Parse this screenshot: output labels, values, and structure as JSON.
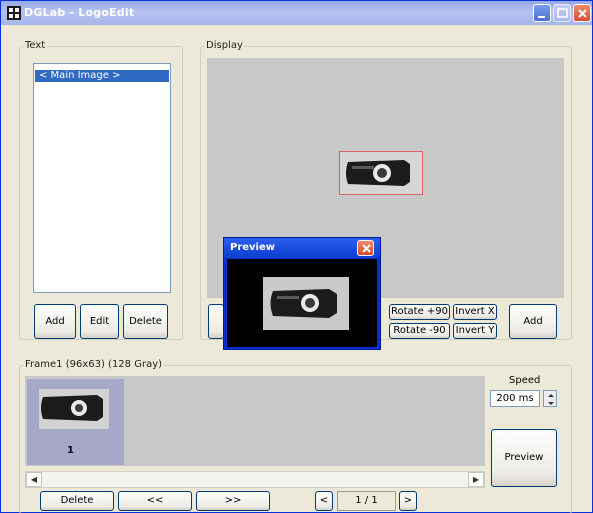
{
  "window": {
    "title": "DGLab - LogoEdit"
  },
  "text_group": {
    "label": "Text",
    "items": [
      "< Main Image >"
    ],
    "add_label": "Add",
    "edit_label": "Edit",
    "delete_label": "Delete"
  },
  "display_group": {
    "label": "Display",
    "rotate_plus_label": "Rotate +90",
    "rotate_minus_label": "Rotate -90",
    "invert_x_label": "Invert X",
    "invert_y_label": "Invert Y",
    "add_label": "Add"
  },
  "preview_window": {
    "title": "Preview"
  },
  "frame_group": {
    "label": "Frame1 (96x63) (128 Gray)",
    "thumb_number": "1",
    "speed_label": "Speed",
    "speed_value": "200 ms",
    "preview_label": "Preview",
    "delete_label": "Delete",
    "prev_label": "<<",
    "next_label": ">>",
    "page_prev": "<",
    "page_next": ">",
    "page_value": "1 / 1"
  },
  "colors": {
    "accent": "#316ac5",
    "title_bar": "#0a3fd0",
    "close": "#d44a28",
    "canvas": "#c8c8c8"
  }
}
